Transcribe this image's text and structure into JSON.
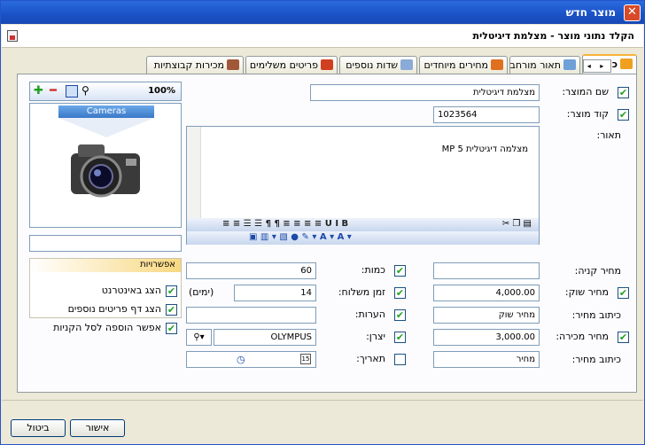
{
  "window": {
    "title": "מוצר חדש",
    "close": "✕",
    "subtitle": "הקלד נתוני מוצר - מצלמת דיגיטלית"
  },
  "tabs": [
    {
      "label": "כללי",
      "icon": "pencil-icon",
      "color": "#f0a020"
    },
    {
      "label": "תאור מורחב",
      "icon": "notepad-icon",
      "color": "#6fa0d8"
    },
    {
      "label": "מחירים מיוחדים",
      "icon": "money-icon",
      "color": "#e07020"
    },
    {
      "label": "שדות נוספים",
      "icon": "grid-icon",
      "color": "#8aaad8"
    },
    {
      "label": "פריטים משלימים",
      "icon": "tiles-icon",
      "color": "#d04020"
    },
    {
      "label": "מכירות קבוצתיות",
      "icon": "group-icon",
      "color": "#a05838"
    }
  ],
  "nav": "◂ ▸",
  "product": {
    "name_label": "שם המוצר:",
    "name_value": "מצלמת דיגיטלית",
    "code_label": "קוד מוצר:",
    "code_value": "1023564",
    "desc_label": "תאור:",
    "desc_value": "מצלמה דיגיטלית 5 MP"
  },
  "image": {
    "zoom": "100%",
    "caption": "Cameras"
  },
  "editor_toolbar": {
    "row1": "≡ ≡ ☰ ☰   ¶ ¶   ≡ ≡ ≡ ≡   U  I  B",
    "row2": "▣  ▥ ▾   ▧ ●    ✎ ▾  A ▾  A ▾"
  },
  "options": {
    "title": "אפשרויות",
    "items": [
      "הצג באינטרנט",
      "הצג דף פריטים נוספים",
      "אפשר הוספה לסל הקניות"
    ]
  },
  "fields": {
    "purchase_price_label": "מחיר קניה:",
    "purchase_price": "",
    "market_price_label": "מחיר שוק:",
    "market_price": "4,000.00",
    "price_caption_label": "כיתוב מחיר:",
    "price_caption_1": "מחיר שוק",
    "sale_price_label": "מחיר מכירה:",
    "sale_price": "3,000.00",
    "price_caption_2": "מחיר",
    "quantity_label": "כמות:",
    "quantity": "60",
    "delivery_label": "זמן משלוח:",
    "delivery": "14",
    "delivery_unit": "(ימים)",
    "notes_label": "הערות:",
    "notes": "",
    "maker_label": "יצרן:",
    "maker": "OLYMPUS",
    "date_label": "תאריך:",
    "date": ""
  },
  "buttons": {
    "ok": "אישור",
    "cancel": "ביטול"
  }
}
